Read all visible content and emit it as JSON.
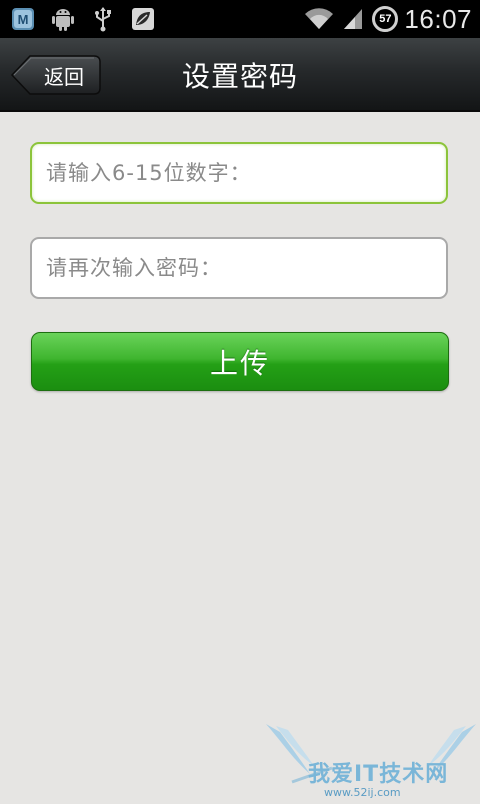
{
  "status_bar": {
    "left_icons": [
      "meizu-app-icon",
      "android-icon",
      "usb-icon",
      "leaf-app-icon"
    ],
    "right_icons": [
      "wifi-icon",
      "signal-icon",
      "battery-icon"
    ],
    "battery_percent": "57",
    "time": "16:07"
  },
  "header": {
    "back_label": "返回",
    "title": "设置密码"
  },
  "form": {
    "password_placeholder": "请输入6-15位数字：",
    "confirm_placeholder": "请再次输入密码：",
    "upload_label": "上传"
  },
  "watermark": {
    "text": "我爱IT技术网",
    "subtext": "www.52ij.com"
  },
  "colors": {
    "accent_green": "#2fa823",
    "focus_border": "#8cc43a"
  }
}
